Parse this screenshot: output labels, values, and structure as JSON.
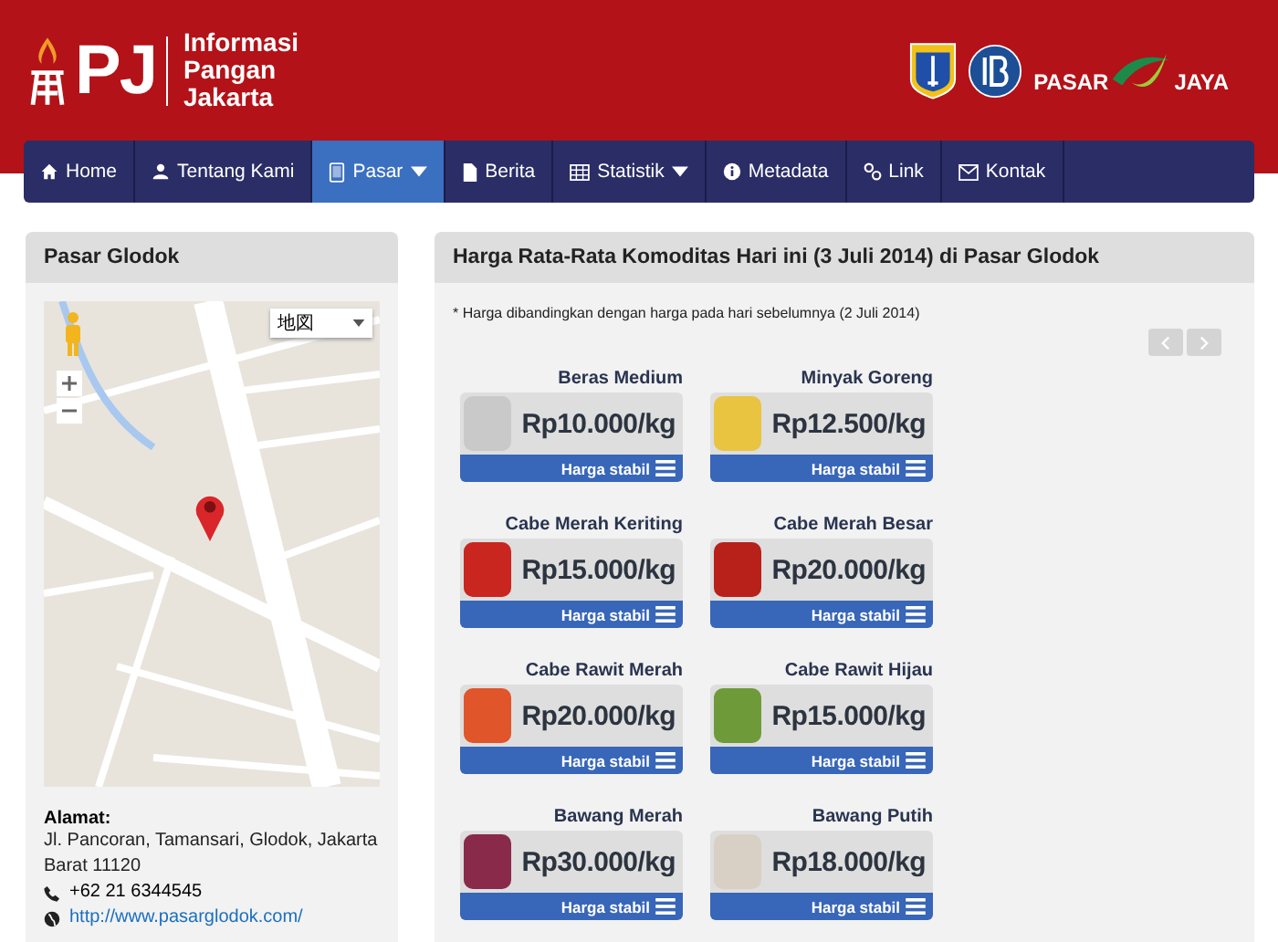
{
  "brand": {
    "mark": "PJ",
    "lines": [
      "Informasi",
      "Pangan",
      "Jakarta"
    ]
  },
  "partner_logos": [
    {
      "kind": "emblem"
    },
    {
      "kind": "bank"
    },
    {
      "kind": "wordmark",
      "words": [
        "PASAR",
        "JAYA"
      ]
    }
  ],
  "nav": [
    {
      "label": "Home",
      "selected": false,
      "dropdown": false
    },
    {
      "label": "Tentang Kami",
      "selected": false,
      "dropdown": false
    },
    {
      "label": "Pasar",
      "selected": true,
      "dropdown": true
    },
    {
      "label": "Berita",
      "selected": false,
      "dropdown": false
    },
    {
      "label": "Statistik",
      "selected": false,
      "dropdown": true
    },
    {
      "label": "Metadata",
      "selected": false,
      "dropdown": false
    },
    {
      "label": "Link",
      "selected": false,
      "dropdown": false
    },
    {
      "label": "Kontak",
      "selected": false,
      "dropdown": false
    }
  ],
  "market_panel": {
    "title": "Pasar Glodok",
    "map": {
      "map_type": "地図"
    },
    "address_label": "Alamat:",
    "address": "Jl. Pancoran, Tamansari, Glodok, Jakarta Barat 11120",
    "phone": "+62 21 6344545",
    "website": "http://www.pasarglodok.com/"
  },
  "prices_panel": {
    "title": "Harga Rata-Rata Komoditas Hari ini (3 Juli 2014) di Pasar Glodok",
    "note": "* Harga dibandingkan dengan harga pada hari sebelumnya (2 Juli 2014)",
    "items": [
      {
        "name": "Beras Medium",
        "price": "Rp10.000/kg",
        "status": "Harga stabil"
      },
      {
        "name": "Minyak Goreng",
        "price": "Rp12.500/kg",
        "status": "Harga stabil"
      },
      {
        "name": "Cabe Merah Keriting",
        "price": "Rp15.000/kg",
        "status": "Harga stabil"
      },
      {
        "name": "Cabe Merah Besar",
        "price": "Rp20.000/kg",
        "status": "Harga stabil"
      },
      {
        "name": "Cabe Rawit Merah",
        "price": "Rp20.000/kg",
        "status": "Harga stabil"
      },
      {
        "name": "Cabe Rawit Hijau",
        "price": "Rp15.000/kg",
        "status": "Harga stabil"
      },
      {
        "name": "Bawang Merah",
        "price": "Rp30.000/kg",
        "status": "Harga stabil"
      },
      {
        "name": "Bawang Putih",
        "price": "Rp18.000/kg",
        "status": "Harga stabil"
      }
    ]
  }
}
